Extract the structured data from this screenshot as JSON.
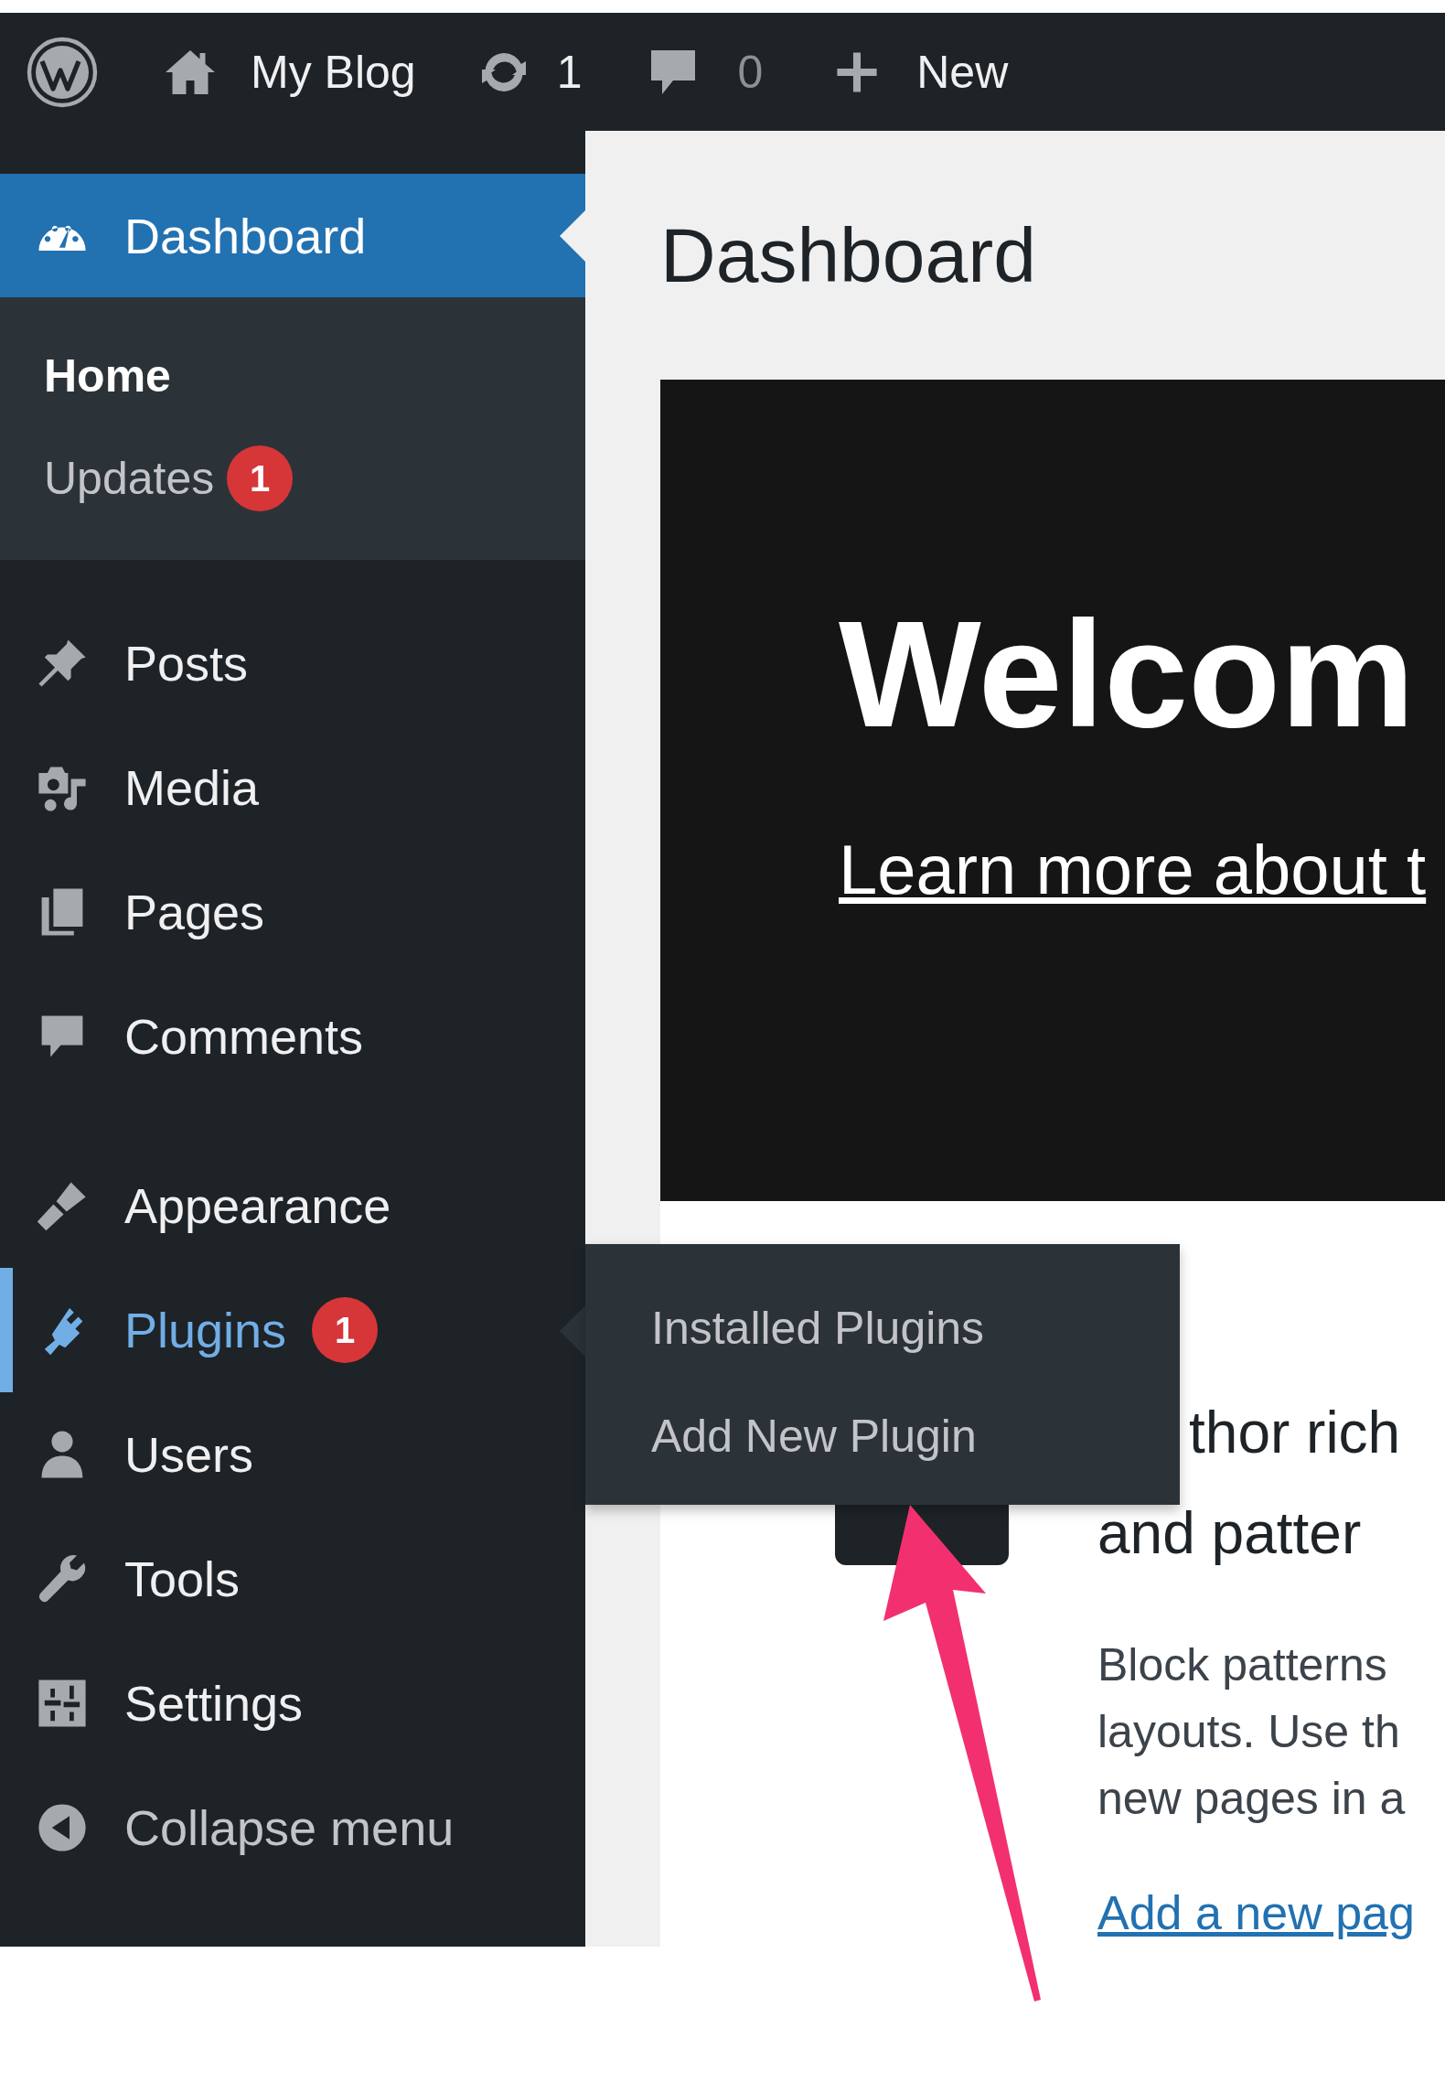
{
  "admin_bar": {
    "site_name": "My Blog",
    "updates_count": "1",
    "comments_count": "0",
    "new_label": "New"
  },
  "sidebar": {
    "groups": [
      {
        "items": [
          {
            "label": "Dashboard",
            "selected": true,
            "hovered": false,
            "submenu": [
              {
                "label": "Home",
                "selected": true
              },
              {
                "label": "Updates",
                "selected": false,
                "badge": "1"
              }
            ]
          }
        ]
      },
      {
        "items": [
          {
            "label": "Posts",
            "selected": false,
            "hovered": false
          },
          {
            "label": "Media",
            "selected": false,
            "hovered": false
          },
          {
            "label": "Pages",
            "selected": false,
            "hovered": false
          },
          {
            "label": "Comments",
            "selected": false,
            "hovered": false
          }
        ]
      },
      {
        "items": [
          {
            "label": "Appearance",
            "selected": false,
            "hovered": false
          },
          {
            "label": "Plugins",
            "selected": false,
            "hovered": true,
            "badge": "1",
            "flyout": [
              {
                "label": "Installed Plugins"
              },
              {
                "label": "Add New Plugin"
              }
            ]
          },
          {
            "label": "Users",
            "selected": false,
            "hovered": false
          },
          {
            "label": "Tools",
            "selected": false,
            "hovered": false
          },
          {
            "label": "Settings",
            "selected": false,
            "hovered": false
          }
        ]
      }
    ],
    "collapse_label": "Collapse menu"
  },
  "page_title": "Dashboard",
  "welcome_panel": {
    "heading": "Welcom",
    "link": "Learn more about t"
  },
  "card": {
    "heading_lines": [
      "thor rich",
      "and patter"
    ],
    "paragraph_lines": [
      "Block patterns",
      "layouts. Use th",
      "new pages in a"
    ],
    "link": "Add a new pag"
  }
}
